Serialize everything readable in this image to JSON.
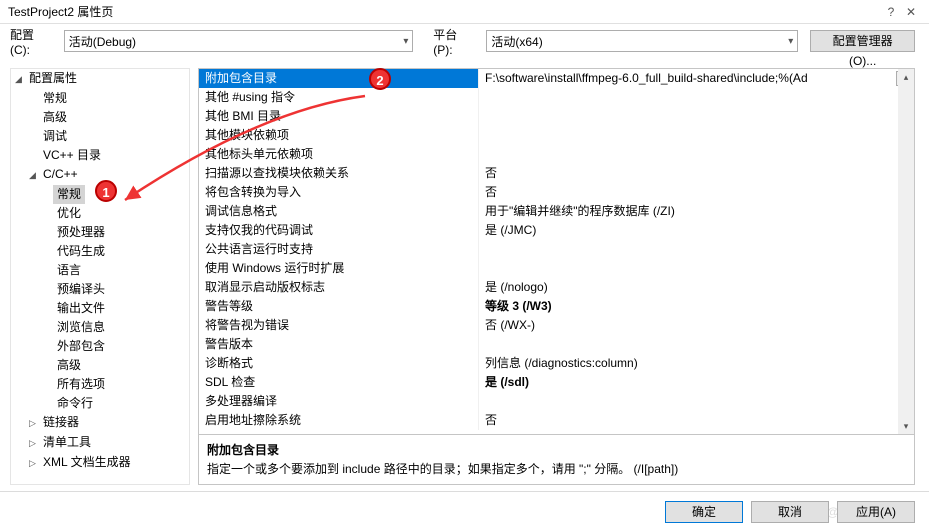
{
  "window": {
    "title": "TestProject2 属性页"
  },
  "toolbar": {
    "config_label": "配置(C):",
    "config_value": "活动(Debug)",
    "platform_label": "平台(P):",
    "platform_value": "活动(x64)",
    "config_mgr": "配置管理器(O)..."
  },
  "tree": {
    "root": "配置属性",
    "items_top": [
      "常规",
      "高级",
      "调试",
      "VC++ 目录"
    ],
    "cpp": "C/C++",
    "cpp_items": [
      "常规",
      "优化",
      "预处理器",
      "代码生成",
      "语言",
      "预编译头",
      "输出文件",
      "浏览信息",
      "外部包含",
      "高级",
      "所有选项",
      "命令行"
    ],
    "items_bottom": [
      "链接器",
      "清单工具",
      "XML 文档生成器"
    ]
  },
  "grid": [
    {
      "name": "附加包含目录",
      "value": "F:\\software\\install\\ffmpeg-6.0_full_build-shared\\include;%(Ad",
      "selected": true
    },
    {
      "name": "其他 #using 指令",
      "value": ""
    },
    {
      "name": "其他 BMI 目录",
      "value": ""
    },
    {
      "name": "其他模块依赖项",
      "value": ""
    },
    {
      "name": "其他标头单元依赖项",
      "value": ""
    },
    {
      "name": "扫描源以查找模块依赖关系",
      "value": "否"
    },
    {
      "name": "将包含转换为导入",
      "value": "否"
    },
    {
      "name": "调试信息格式",
      "value": "用于\"编辑并继续\"的程序数据库 (/ZI)"
    },
    {
      "name": "支持仅我的代码调试",
      "value": "是 (/JMC)"
    },
    {
      "name": "公共语言运行时支持",
      "value": ""
    },
    {
      "name": "使用 Windows 运行时扩展",
      "value": ""
    },
    {
      "name": "取消显示启动版权标志",
      "value": "是 (/nologo)"
    },
    {
      "name": "警告等级",
      "value": "等级 3 (/W3)",
      "bold": true
    },
    {
      "name": "将警告视为错误",
      "value": "否 (/WX-)"
    },
    {
      "name": "警告版本",
      "value": ""
    },
    {
      "name": "诊断格式",
      "value": "列信息 (/diagnostics:column)"
    },
    {
      "name": "SDL 检查",
      "value": "是 (/sdl)",
      "bold": true
    },
    {
      "name": "多处理器编译",
      "value": ""
    },
    {
      "name": "启用地址擦除系统",
      "value": "否"
    }
  ],
  "desc": {
    "title": "附加包含目录",
    "body": "指定一个或多个要添加到 include 路径中的目录；如果指定多个，请用 \";\" 分隔。 (/I[path])"
  },
  "buttons": {
    "ok": "确定",
    "cancel": "取消",
    "apply": "应用(A)"
  },
  "watermark": "CSDN @SunnyFish-ty",
  "markers": {
    "m1": "1",
    "m2": "2"
  }
}
